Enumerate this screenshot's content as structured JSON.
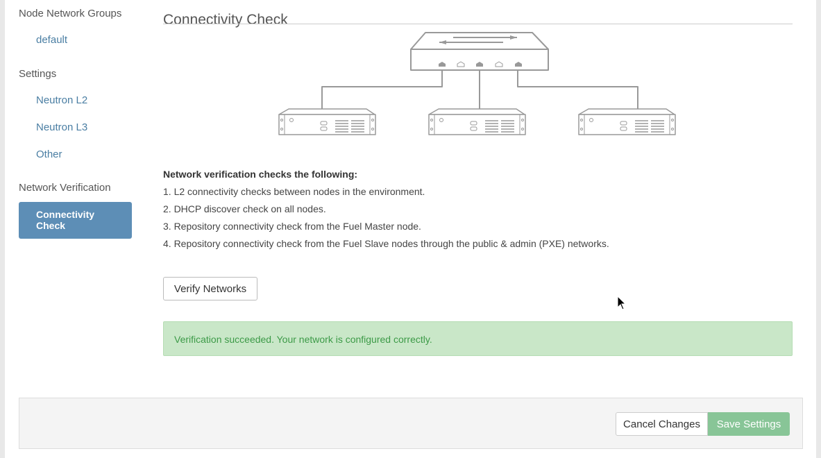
{
  "sidebar": {
    "node_network_groups_title": "Node Network Groups",
    "node_network_groups": [
      "default"
    ],
    "settings_title": "Settings",
    "settings_items": [
      "Neutron L2",
      "Neutron L3",
      "Other"
    ],
    "network_verification_title": "Network Verification",
    "active_item": "Connectivity Check"
  },
  "main": {
    "title": "Connectivity Check",
    "description_heading": "Network verification checks the following:",
    "checks": [
      "1. L2 connectivity checks between nodes in the environment.",
      "2. DHCP discover check on all nodes.",
      "3. Repository connectivity check from the Fuel Master node.",
      "4. Repository connectivity check from the Fuel Slave nodes through the public & admin (PXE) networks."
    ],
    "verify_button": "Verify Networks",
    "success_message": "Verification succeeded. Your network is configured correctly."
  },
  "footer": {
    "cancel_button": "Cancel Changes",
    "save_button": "Save Settings"
  },
  "colors": {
    "accent": "#5d8eb6",
    "link": "#4a7ea3",
    "success_bg": "#c9e7c8",
    "success_text": "#3c9a47",
    "save_button": "#88c597"
  },
  "icons": {
    "switch": "network-switch-icon",
    "server": "server-icon",
    "cursor": "mouse-cursor-icon"
  }
}
